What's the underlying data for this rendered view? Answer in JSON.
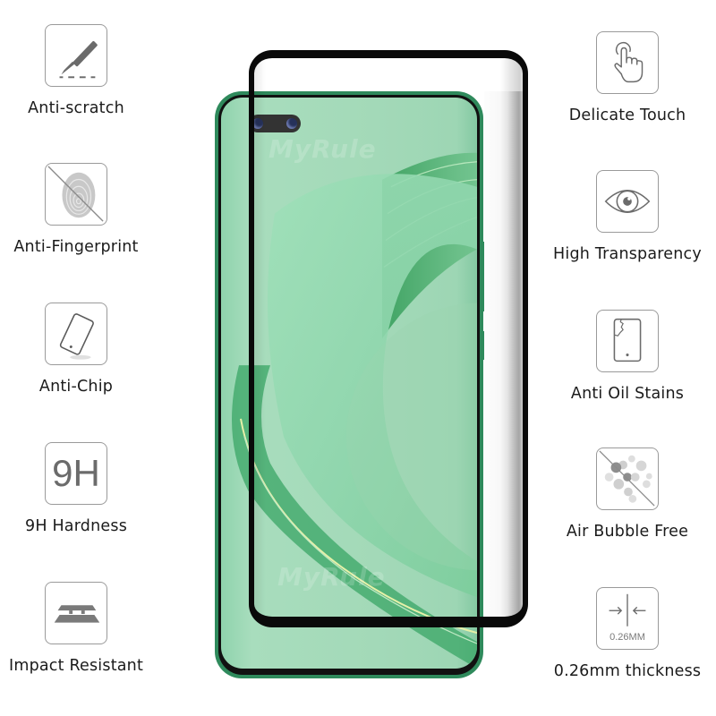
{
  "left_features": [
    {
      "id": "anti-scratch",
      "label": "Anti-scratch",
      "icon": "scalpel-icon"
    },
    {
      "id": "anti-fingerprint",
      "label": "Anti-Fingerprint",
      "icon": "fingerprint-crossed-icon"
    },
    {
      "id": "anti-chip",
      "label": "Anti-Chip",
      "icon": "tilted-phone-icon"
    },
    {
      "id": "9h-hardness",
      "label": "9H Hardness",
      "icon": "9h-text-icon",
      "icon_text": "9H"
    },
    {
      "id": "impact-resistant",
      "label": "Impact Resistant",
      "icon": "layers-icon"
    }
  ],
  "right_features": [
    {
      "id": "delicate-touch",
      "label": "Delicate Touch",
      "icon": "touch-hand-icon"
    },
    {
      "id": "high-transparency",
      "label": "High Transparency",
      "icon": "eye-icon"
    },
    {
      "id": "anti-oil-stains",
      "label": "Anti Oil Stains",
      "icon": "phone-stain-icon"
    },
    {
      "id": "air-bubble-free",
      "label": "Air Bubble Free",
      "icon": "bubbles-crossed-icon"
    },
    {
      "id": "thickness",
      "label": "0.26mm thickness",
      "icon": "thickness-arrows-icon",
      "icon_text": "0.26MM"
    }
  ],
  "product": {
    "description": "Curved tempered glass screen protector over green smartphone",
    "watermark": "MyRule",
    "colors": {
      "phone_frame": "#2f8a5c",
      "screen": "#a3d9b8",
      "glass_edge": "#0a0a0a",
      "icon_gray": "#6b6b6b"
    }
  }
}
